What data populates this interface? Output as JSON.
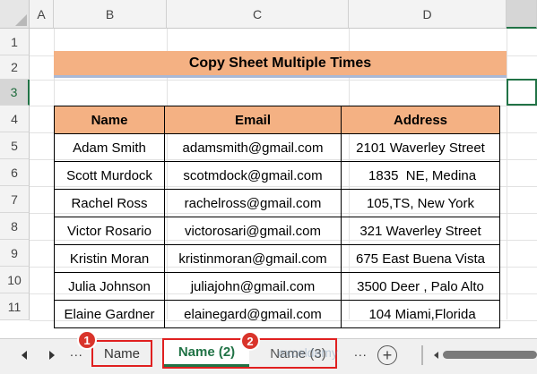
{
  "columns": [
    "A",
    "B",
    "C",
    "D"
  ],
  "rows": [
    "1",
    "2",
    "3",
    "4",
    "5",
    "6",
    "7",
    "8",
    "9",
    "10",
    "11"
  ],
  "title": "Copy Sheet Multiple Times",
  "table": {
    "headers": [
      "Name",
      "Email",
      "Address"
    ],
    "rows": [
      [
        "Adam Smith",
        "adamsmith@gmail.com",
        "2101 Waverley Street"
      ],
      [
        "Scott Murdock",
        "scotmdock@gmail.com",
        " 1835  NE, Medina"
      ],
      [
        "Rachel Ross",
        "rachelross@gmail.com",
        "105,TS, New York"
      ],
      [
        "Victor Rosario",
        "victorosari@gmail.com",
        "321 Waverley Street"
      ],
      [
        "Kristin Moran",
        "kristinmoran@gmail.com",
        "675 East Buena Vista"
      ],
      [
        "Julia Johnson",
        "juliajohn@gmail.com",
        "3500 Deer , Palo Alto"
      ],
      [
        "Elaine Gardner",
        "elainegard@gmail.com",
        " 104 Miami,Florida"
      ]
    ]
  },
  "sheet_tabs": {
    "more_left": "...",
    "more_right": "...",
    "tabs": [
      "Name",
      "Name (2)",
      "Name (3)"
    ],
    "active_tab": "Name (2)",
    "add_symbol": "+"
  },
  "callouts": [
    "1",
    "2"
  ],
  "watermark": "exceldemy",
  "colors": {
    "header_fill": "#f4b183",
    "excel_green": "#217346",
    "callout_red": "#d9342b"
  }
}
